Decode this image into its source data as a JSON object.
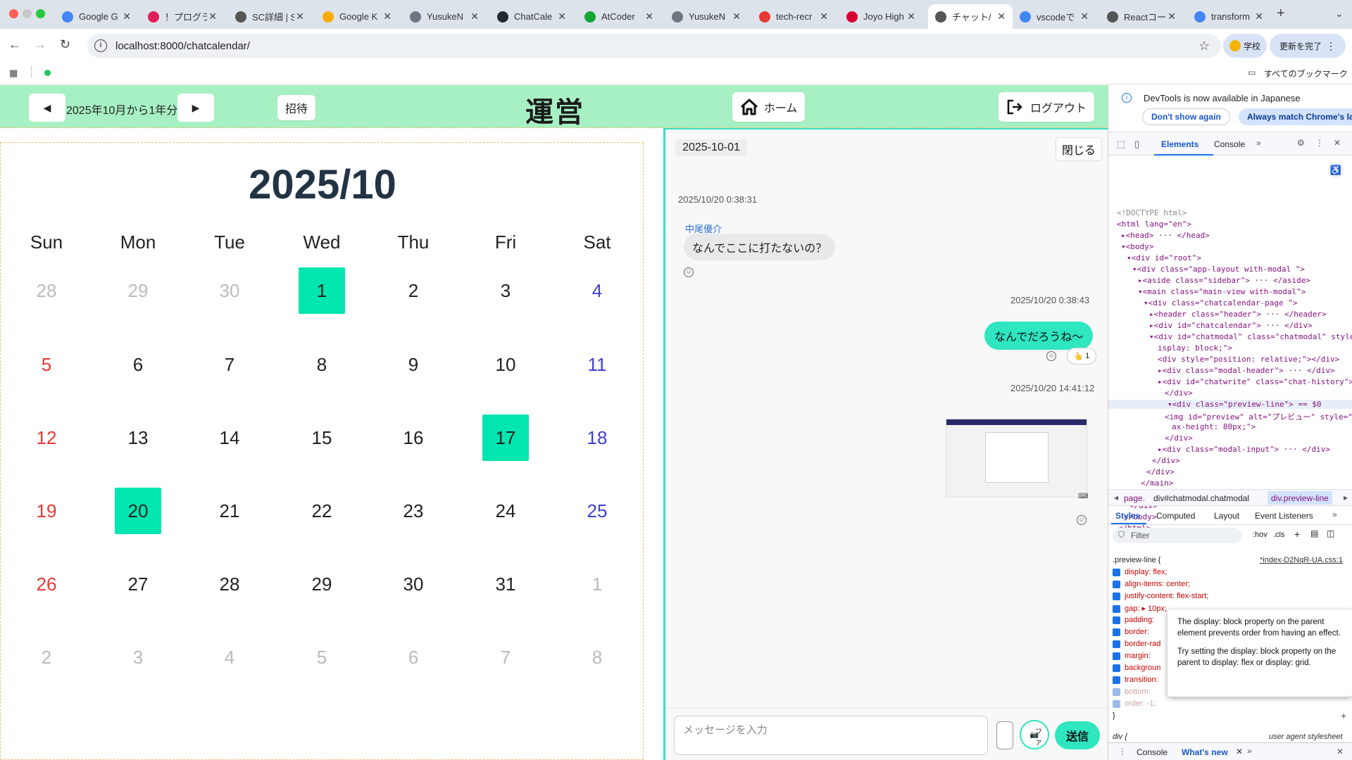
{
  "browser": {
    "tabs": [
      {
        "label": "Google G",
        "color": "#4285f4"
      },
      {
        "label": "！プログラ",
        "color": "#e01e5a"
      },
      {
        "label": "SC詳細 | S",
        "color": "#555555"
      },
      {
        "label": "Google K",
        "color": "#f9ab00"
      },
      {
        "label": "YusukeN",
        "color": "#6e7781"
      },
      {
        "label": "ChatCale",
        "color": "#24292f"
      },
      {
        "label": "AtCoder",
        "color": "#13a538"
      },
      {
        "label": "YusukeN",
        "color": "#6e7781"
      },
      {
        "label": "tech-recr",
        "color": "#e53935"
      },
      {
        "label": "Joyo High",
        "color": "#d50032"
      },
      {
        "label": "チャット/",
        "color": "#555555"
      },
      {
        "label": "vscodeで",
        "color": "#4285f4"
      },
      {
        "label": "Reactコー",
        "color": "#555555"
      },
      {
        "label": "transform",
        "color": "#4285f4"
      }
    ],
    "active_tab_index": 10,
    "new_tab": "+",
    "url": "localhost:8000/chatcalendar/",
    "profile_label": "学校",
    "update_label": "更新を完了",
    "bookmarks_all": "すべてのブックマーク"
  },
  "header": {
    "range_label": "2025年10月から1年分",
    "prev": "◀",
    "next": "▶",
    "invite": "招待",
    "title": "運営",
    "home": "ホーム",
    "logout": "ログアウト"
  },
  "calendar": {
    "title": "2025/10",
    "weekdays": [
      "Sun",
      "Mon",
      "Tue",
      "Wed",
      "Thu",
      "Fri",
      "Sat"
    ],
    "weeks": [
      [
        {
          "d": "28",
          "t": "other"
        },
        {
          "d": "29",
          "t": "other"
        },
        {
          "d": "30",
          "t": "other"
        },
        {
          "d": "1",
          "t": "mark"
        },
        {
          "d": "2",
          "t": ""
        },
        {
          "d": "3",
          "t": ""
        },
        {
          "d": "4",
          "t": "sat"
        }
      ],
      [
        {
          "d": "5",
          "t": "sun"
        },
        {
          "d": "6",
          "t": ""
        },
        {
          "d": "7",
          "t": ""
        },
        {
          "d": "8",
          "t": ""
        },
        {
          "d": "9",
          "t": ""
        },
        {
          "d": "10",
          "t": ""
        },
        {
          "d": "11",
          "t": "sat"
        }
      ],
      [
        {
          "d": "12",
          "t": "sun"
        },
        {
          "d": "13",
          "t": ""
        },
        {
          "d": "14",
          "t": ""
        },
        {
          "d": "15",
          "t": ""
        },
        {
          "d": "16",
          "t": ""
        },
        {
          "d": "17",
          "t": "mark"
        },
        {
          "d": "18",
          "t": "sat"
        }
      ],
      [
        {
          "d": "19",
          "t": "sun"
        },
        {
          "d": "20",
          "t": "mark"
        },
        {
          "d": "21",
          "t": ""
        },
        {
          "d": "22",
          "t": ""
        },
        {
          "d": "23",
          "t": ""
        },
        {
          "d": "24",
          "t": ""
        },
        {
          "d": "25",
          "t": "sat"
        }
      ],
      [
        {
          "d": "26",
          "t": "sun"
        },
        {
          "d": "27",
          "t": ""
        },
        {
          "d": "28",
          "t": ""
        },
        {
          "d": "29",
          "t": ""
        },
        {
          "d": "30",
          "t": ""
        },
        {
          "d": "31",
          "t": ""
        },
        {
          "d": "1",
          "t": "other"
        }
      ],
      [
        {
          "d": "2",
          "t": "other"
        },
        {
          "d": "3",
          "t": "other"
        },
        {
          "d": "4",
          "t": "other"
        },
        {
          "d": "5",
          "t": "other"
        },
        {
          "d": "6",
          "t": "other"
        },
        {
          "d": "7",
          "t": "other"
        },
        {
          "d": "8",
          "t": "other"
        }
      ]
    ]
  },
  "chat": {
    "date": "2025-10-01",
    "close": "閉じる",
    "ts1": "2025/10/20 0:38:31",
    "sender": "中尾優介",
    "msg1": "なんでここに打たないの？",
    "ts2": "2025/10/20 0:38:43",
    "msg2": "なんでだろうね〜",
    "reaction_count": "1",
    "ts3": "2025/10/20 14:41:12",
    "input_placeholder": "メッセージを入力",
    "camera": "ファ",
    "send": "送信"
  },
  "devtools": {
    "banner": "DevTools is now available in Japanese",
    "dont_show": "Don't show again",
    "always_match": "Always match Chrome's la",
    "tabs": [
      "Elements",
      "Console"
    ],
    "dom": [
      "<!DOCTYPE html>",
      "<html lang=\"en\">",
      "▸<head> ··· </head>",
      "▾<body>",
      "▾<div id=\"root\">",
      "▾<div class=\"app-layout with-modal \">",
      "▸<aside class=\"sidebar\"> ··· </aside>",
      "▾<main class=\"main-view with-modal\">",
      "▾<div class=\"chatcalendar-page \">",
      "▸<header class=\"header\"> ··· </header>",
      "▸<div id=\"chatcalendar\"> ··· </div>",
      "▾<div id=\"chatmodal\" class=\"chatmodal\" style=\"d",
      "isplay: block;\">",
      "<div style=\"position: relative;\"></div>",
      "▸<div class=\"modal-header\"> ··· </div>",
      "▸<div id=\"chatwrite\" class=\"chat-history\"> ···",
      "</div>",
      "▾<div class=\"preview-line\"> == $0",
      "<img id=\"preview\" alt=\"プレビュー\" style=\"m",
      "ax-height: 80px;\">",
      "</div>",
      "▸<div class=\"modal-input\"> ··· </div>",
      "</div>",
      "</div>",
      "</main>",
      "</div>",
      "</div>",
      "</body>",
      "</html>"
    ],
    "breadcrumb": [
      "page.",
      "div#chatmodal.chatmodal",
      "div.preview-line"
    ],
    "style_tabs": [
      "Styles",
      "Computed",
      "Layout",
      "Event Listeners"
    ],
    "filter": "Filter",
    "hov": ":hov",
    "cls": ".cls",
    "rule_selector": ".preview-line {",
    "rule_source": "*index-D2NqR-UA.css:1",
    "props": [
      "display: flex;",
      "align-items: center;",
      "justify-content: flex-start;",
      "gap: ▸ 10px;",
      "padding:",
      "border:",
      "border-rad",
      "margin:",
      "backgroun",
      "transition:",
      "bottom:",
      "order: -1;"
    ],
    "tooltip_1": "The display: block property on the parent element prevents order from having an effect.",
    "tooltip_2": "Try setting the display: block property on the parent to display: flex or display: grid.",
    "ua_rule": "div {",
    "ua_label": "user agent stylesheet",
    "drawer_console": "Console",
    "drawer_whatsnew": "What's new"
  }
}
